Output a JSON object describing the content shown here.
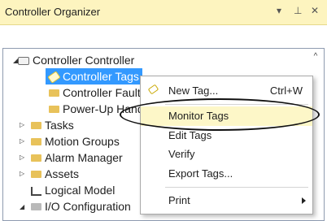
{
  "window": {
    "title": "Controller Organizer",
    "buttons": {
      "dropdown": "▾",
      "pin": "⊥",
      "close": "✕"
    }
  },
  "toolbar": {
    "icons": [
      "collapse-all-icon",
      "list-view-icon"
    ]
  },
  "tree": {
    "items": [
      {
        "label": "Controller Controller",
        "icon": "controller-icon",
        "expander": "expanded"
      },
      {
        "label": "Controller Tags",
        "icon": "tag-icon",
        "selected": true
      },
      {
        "label": "Controller Fault",
        "icon": "folder-icon"
      },
      {
        "label": "Power-Up Hand",
        "icon": "folder-icon"
      },
      {
        "label": "Tasks",
        "icon": "folder-icon",
        "expander": "collapsed"
      },
      {
        "label": "Motion Groups",
        "icon": "folder-icon",
        "expander": "collapsed"
      },
      {
        "label": "Alarm Manager",
        "icon": "folder-icon",
        "expander": "collapsed"
      },
      {
        "label": "Assets",
        "icon": "folder-icon",
        "expander": "collapsed"
      },
      {
        "label": "Logical Model",
        "icon": "logical-model-icon"
      },
      {
        "label": "I/O Configuration",
        "icon": "folder-icon",
        "expander": "expanded"
      }
    ]
  },
  "context_menu": {
    "items": [
      {
        "label": "New Tag...",
        "shortcut": "Ctrl+W",
        "icon": "tag-icon"
      },
      {
        "label": "Monitor Tags",
        "highlighted": true
      },
      {
        "label": "Edit Tags"
      },
      {
        "label": "Verify"
      },
      {
        "label": "Export Tags..."
      },
      {
        "label": "Print",
        "submenu": true
      }
    ]
  },
  "colors": {
    "titlebar_bg": "#fdf4bf",
    "selection_bg": "#3399ff",
    "menu_highlight_bg": "#fdf7c8",
    "folder_icon": "#e8c25a"
  }
}
